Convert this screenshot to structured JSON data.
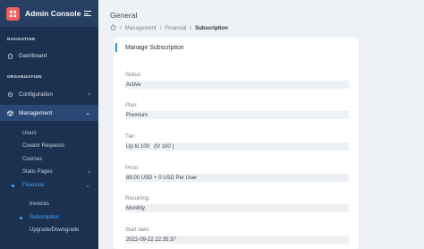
{
  "app": {
    "title": "Admin Console"
  },
  "sidebar": {
    "sections": {
      "navigation": "NAVIGATION",
      "organization": "ORGANIZATION"
    },
    "items": {
      "dashboard": "Dashboard",
      "configuration": "Configuration",
      "management": "Management"
    },
    "management_children": {
      "users": "Users",
      "creator_requests": "Creator Requests",
      "courses": "Courses",
      "static_pages": "Static Pages",
      "financial": "Financial"
    },
    "financial_children": {
      "invoices": "Invoices",
      "subscription": "Subscription",
      "upgrade_downgrade": "Upgrade/Downgrade"
    }
  },
  "header": {
    "title": "General",
    "breadcrumb": [
      "Management",
      "Financial",
      "Subscription"
    ]
  },
  "card": {
    "title": "Manage Subscription",
    "fields": [
      {
        "label": "Status:",
        "value": "Active"
      },
      {
        "label": "Plan:",
        "value": "Premium"
      },
      {
        "label": "Tier:",
        "value": "Up to 100   (0/ 100 )"
      },
      {
        "label": "Price:",
        "value": "89.00 USD + 0 USD Per User"
      },
      {
        "label": "Recurring:",
        "value": "Monthly"
      },
      {
        "label": "Start date:",
        "value": "2022-09-22 22:35:37"
      }
    ]
  },
  "colors": {
    "sidebar_bg": "#1c3150",
    "accent": "#3b8be0",
    "active_link": "#4aa8ff",
    "logo": "#ef5f5f"
  },
  "icons": [
    "logo-icon",
    "hamburger-icon",
    "home-icon",
    "gear-icon",
    "box-icon",
    "chevron-right-icon",
    "chevron-down-icon"
  ]
}
